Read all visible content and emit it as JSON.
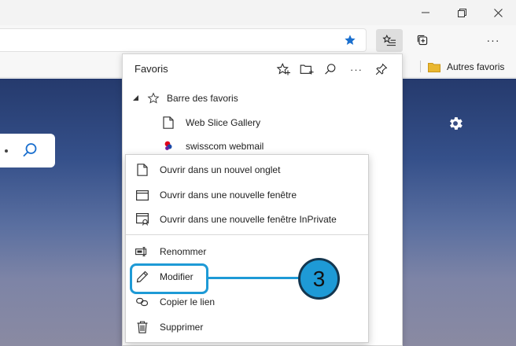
{
  "colors": {
    "accent": "#1e9ad6",
    "star_blue": "#1a6fce",
    "folder_yellow": "#e9b730"
  },
  "titlebar": {
    "controls": [
      "minimize-icon",
      "restore-icon",
      "close-icon"
    ]
  },
  "toolbar": {
    "more_label": "···"
  },
  "favorites_bar": {
    "folder_label": "Autres favoris"
  },
  "panel": {
    "title": "Favoris",
    "tree": [
      {
        "label": "Barre des favoris",
        "icon": "star-outline-icon",
        "expanded": true
      },
      {
        "label": "Web Slice Gallery",
        "icon": "page-icon"
      },
      {
        "label": "swisscom webmail",
        "icon": "swisscom-favicon"
      }
    ]
  },
  "context_menu": {
    "items": [
      {
        "label": "Ouvrir dans un nouvel onglet",
        "icon": "new-tab-icon"
      },
      {
        "label": "Ouvrir dans une nouvelle fenêtre",
        "icon": "new-window-icon"
      },
      {
        "label": "Ouvrir dans une nouvelle fenêtre InPrivate",
        "icon": "inprivate-window-icon"
      },
      {
        "label": "Renommer",
        "icon": "rename-icon"
      },
      {
        "label": "Modifier",
        "icon": "pencil-icon"
      },
      {
        "label": "Copier le lien",
        "icon": "link-icon"
      },
      {
        "label": "Supprimer",
        "icon": "trash-icon"
      }
    ]
  },
  "callout": {
    "number": "3"
  }
}
